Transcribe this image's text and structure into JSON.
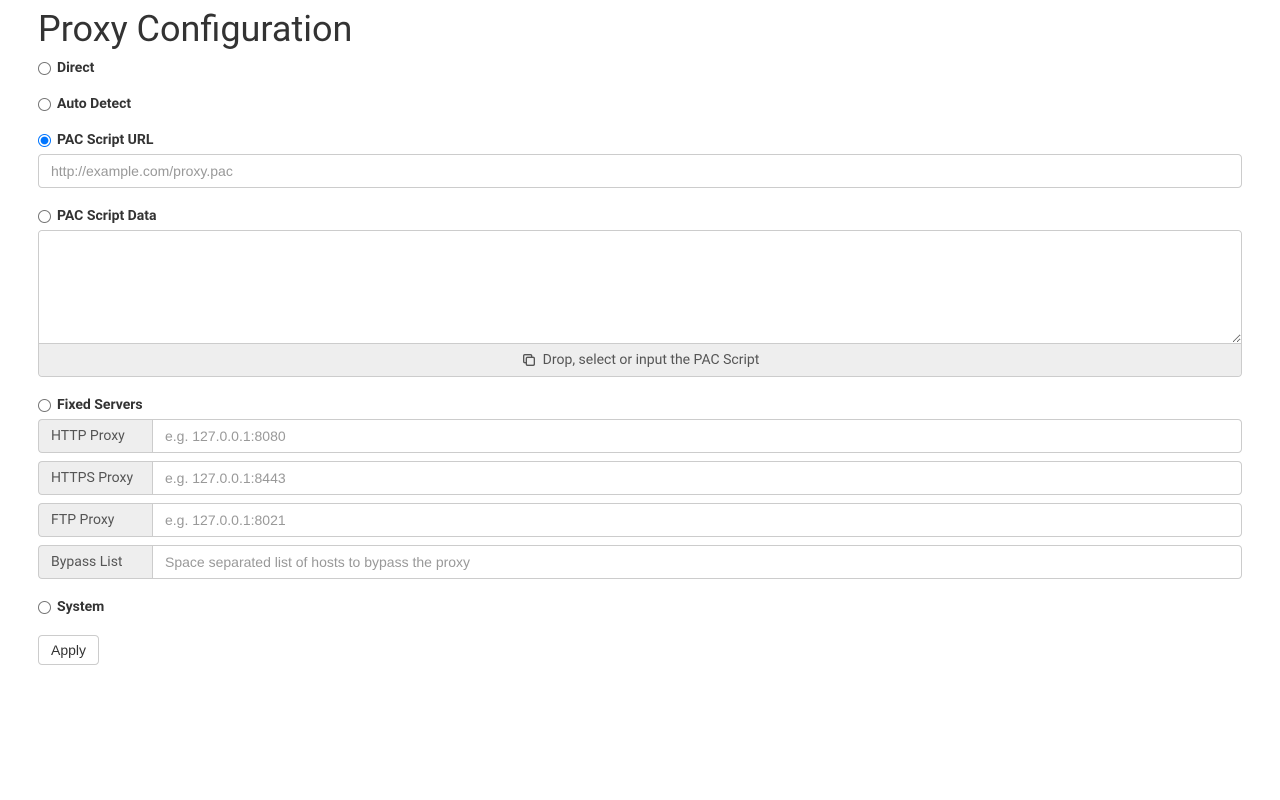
{
  "title": "Proxy Configuration",
  "options": {
    "direct": {
      "label": "Direct"
    },
    "autoDetect": {
      "label": "Auto Detect"
    },
    "pacUrl": {
      "label": "PAC Script URL",
      "placeholder": "http://example.com/proxy.pac",
      "value": ""
    },
    "pacData": {
      "label": "PAC Script Data",
      "value": "",
      "hint": "Drop, select or input the PAC Script"
    },
    "fixed": {
      "label": "Fixed Servers",
      "http": {
        "label": "HTTP Proxy",
        "placeholder": "e.g. 127.0.0.1:8080",
        "value": ""
      },
      "https": {
        "label": "HTTPS Proxy",
        "placeholder": "e.g. 127.0.0.1:8443",
        "value": ""
      },
      "ftp": {
        "label": "FTP Proxy",
        "placeholder": "e.g. 127.0.0.1:8021",
        "value": ""
      },
      "bypass": {
        "label": "Bypass List",
        "placeholder": "Space separated list of hosts to bypass the proxy",
        "value": ""
      }
    },
    "system": {
      "label": "System"
    }
  },
  "selected": "pacUrl",
  "actions": {
    "apply": "Apply"
  }
}
